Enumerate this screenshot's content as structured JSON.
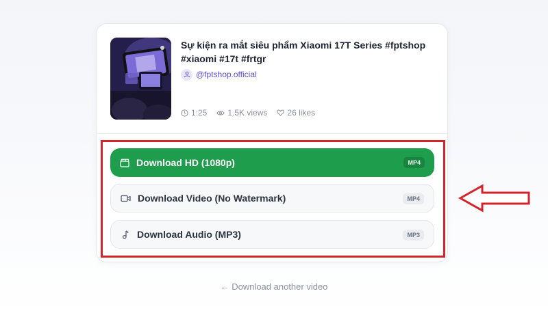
{
  "video": {
    "title": "Sự kiện ra mắt siêu phẩm Xiaomi 17T Series #fptshop #xiaomi #17t #frtgr",
    "channel": "@fptshop.official",
    "duration": "1:25",
    "views": "1.5K views",
    "likes": "26 likes",
    "thumbnail_icon": "video-thumbnail"
  },
  "downloads": {
    "hd": {
      "label": "Download HD (1080p)",
      "badge": "MP4",
      "icon": "clapperboard-icon"
    },
    "video": {
      "label": "Download Video (No Watermark)",
      "badge": "MP4",
      "icon": "video-camera-icon"
    },
    "audio": {
      "label": "Download Audio (MP3)",
      "badge": "MP3",
      "icon": "music-note-icon"
    }
  },
  "footer": {
    "another_label": "Download another video",
    "arrow": "←"
  },
  "colors": {
    "primary_green": "#1e9d4c",
    "annotation_red": "#d3232b",
    "channel_purple": "#5b4bd6",
    "muted_text": "#8a909c"
  }
}
